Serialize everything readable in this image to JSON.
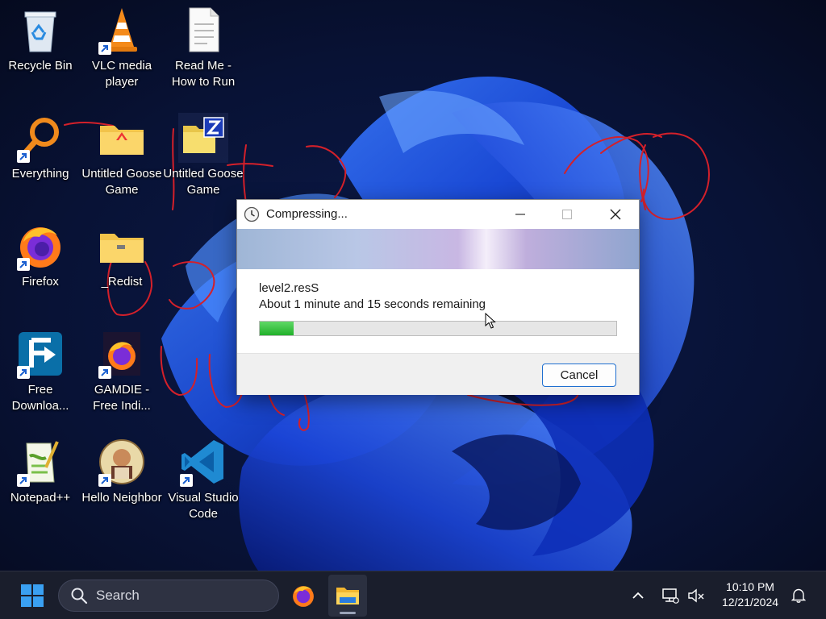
{
  "desktop": {
    "icons": [
      {
        "label": "Recycle Bin",
        "icon": "recycle-bin-icon"
      },
      {
        "label": "VLC media player",
        "icon": "vlc-icon"
      },
      {
        "label": "Read Me - How to Run",
        "icon": "text-file-icon"
      },
      {
        "label": "Everything",
        "icon": "everything-search-icon"
      },
      {
        "label": "Untitled Goose Game",
        "icon": "folder-icon"
      },
      {
        "label": "Untitled Goose Game",
        "icon": "winzip-icon"
      },
      {
        "label": "Firefox",
        "icon": "firefox-icon"
      },
      {
        "label": "_Redist",
        "icon": "folder-icon"
      },
      {
        "label": "Free Downloa...",
        "icon": "free-download-manager-icon"
      },
      {
        "label": "GAMDIE - Free Indi...",
        "icon": "firefox-icon"
      },
      {
        "label": "Notepad++",
        "icon": "notepad-plus-plus-icon"
      },
      {
        "label": "Hello Neighbor",
        "icon": "hello-neighbor-icon"
      },
      {
        "label": "Visual Studio Code",
        "icon": "vscode-icon"
      }
    ]
  },
  "dialog": {
    "title": "Compressing...",
    "title_icon": "clock-icon",
    "filename": "level2.resS",
    "remaining": "About 1 minute and 15 seconds remaining",
    "progress_fraction": 0.095,
    "progress_color": "#2cb834",
    "cancel_label": "Cancel"
  },
  "taskbar": {
    "search_placeholder": "Search",
    "pinned": [
      "windows-start-icon",
      "firefox-icon",
      "file-explorer-icon"
    ],
    "tray_icons": [
      "chevron-up-icon",
      "network-icon",
      "volume-muted-icon",
      "notification-bell-icon"
    ],
    "time": "10:10 PM",
    "date": "12/21/2024"
  },
  "colors": {
    "wallpaper_dark": "#070d24",
    "wallpaper_blue": "#1846e0",
    "scribble": "#d4202a",
    "accent": "#1f6fd0"
  }
}
